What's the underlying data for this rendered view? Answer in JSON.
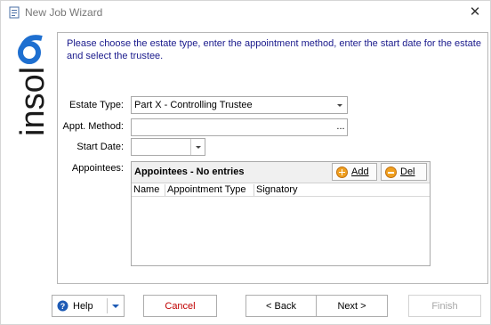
{
  "window": {
    "title": "New Job Wizard",
    "close_glyph": "✕"
  },
  "brand": {
    "logo_text": "insol6"
  },
  "instructions": "Please choose the estate type, enter the appointment method, enter the start date for the estate and select the trustee.",
  "form": {
    "estate_type_label": "Estate Type:",
    "estate_type_value": "Part X - Controlling Trustee",
    "appt_method_label": "Appt. Method:",
    "appt_method_value": "",
    "appt_method_button": "...",
    "start_date_label": "Start Date:",
    "start_date_value": "",
    "appointees_label": "Appointees:"
  },
  "appointees": {
    "title": "Appointees - No entries",
    "add_label": "Add",
    "del_label": "Del",
    "columns": [
      "Name",
      "Appointment Type",
      "Signatory"
    ]
  },
  "footer": {
    "help": "Help",
    "cancel": "Cancel",
    "back": "< Back",
    "next": "Next >",
    "finish": "Finish"
  },
  "colors": {
    "instructions": "#1a1a8c",
    "cancel": "#c00000",
    "logo": "#1a1a1a",
    "logo_accent": "#1e6fd0",
    "icon_orange": "#f0a020"
  }
}
